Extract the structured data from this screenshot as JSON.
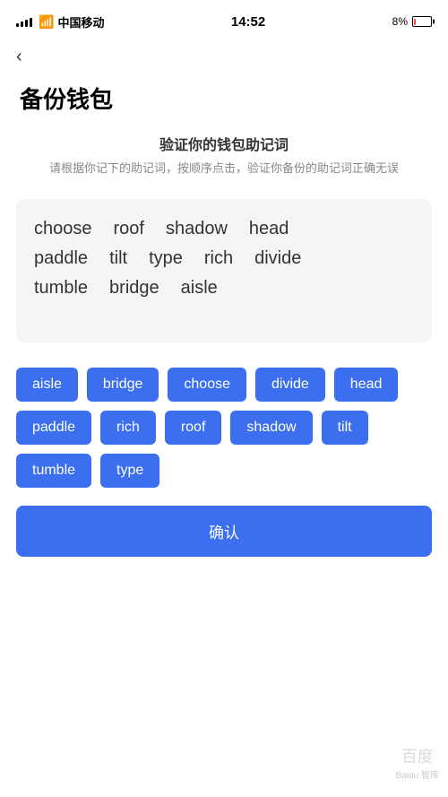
{
  "statusBar": {
    "carrier": "中国移动",
    "time": "14:52",
    "battery_percent": "8%"
  },
  "back": {
    "icon": "‹"
  },
  "page": {
    "title": "备份钱包"
  },
  "verifySection": {
    "title": "验证你的钱包助记词",
    "description": "请根据你记下的助记词，按顺序点击，验证你备份的助记词正确无误"
  },
  "displayWords": {
    "row1": [
      "choose",
      "roof",
      "shadow",
      "head"
    ],
    "row2": [
      "paddle",
      "tilt",
      "type",
      "rich",
      "divide"
    ],
    "row3": [
      "tumble",
      "bridge",
      "aisle"
    ]
  },
  "wordButtons": [
    "aisle",
    "bridge",
    "choose",
    "divide",
    "head",
    "paddle",
    "rich",
    "roof",
    "shadow",
    "tilt",
    "tumble",
    "type"
  ],
  "confirmButton": {
    "label": "确认"
  }
}
